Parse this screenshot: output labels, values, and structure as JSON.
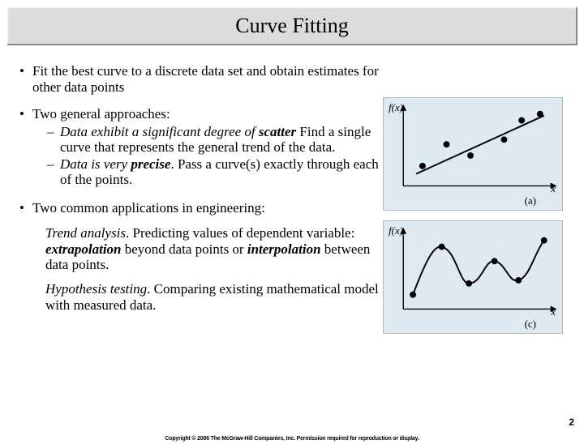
{
  "title": "Curve Fitting",
  "bullets": {
    "b1": "Fit the best curve to a discrete data set and obtain estimates for other data points",
    "b2": {
      "lead": "Two general approaches:",
      "s1_em": "Data exhibit a significant degree of ",
      "s1_bold": "scatter",
      "s1_tail": " Find a single curve that represents the general trend of the data.",
      "s2_em": "Data is very ",
      "s2_bold": "precise",
      "s2_tail": ". Pass a curve(s) exactly through each of the points."
    },
    "b3": {
      "lead": "Two common applications in engineering:",
      "p1_title": "Trend analysis",
      "p1_body1": ". Predicting values of dependent variable: ",
      "p1_kw1": "extrapolation",
      "p1_body2": " beyond data points or ",
      "p1_kw2": "interpolation",
      "p1_body3": " between data points.",
      "p2_title": "Hypothesis testing",
      "p2_body": ". Comparing existing mathematical model with measured data."
    }
  },
  "figures": {
    "a": {
      "y_label": "f(x)",
      "x_label": "x",
      "tag": "(a)"
    },
    "c": {
      "y_label": "f(x)",
      "x_label": "x",
      "tag": "(c)"
    }
  },
  "chart_data": [
    {
      "type": "scatter",
      "tag": "(a)",
      "note": "scatter points with a straight trend line",
      "points": [
        {
          "x": 0.1,
          "y": 0.3
        },
        {
          "x": 0.28,
          "y": 0.55
        },
        {
          "x": 0.45,
          "y": 0.42
        },
        {
          "x": 0.7,
          "y": 0.6
        },
        {
          "x": 0.82,
          "y": 0.83
        },
        {
          "x": 0.93,
          "y": 0.92
        }
      ],
      "line": {
        "x0": 0.05,
        "y0": 0.25,
        "x1": 0.95,
        "y1": 0.9
      }
    },
    {
      "type": "line",
      "tag": "(c)",
      "note": "smooth curve passing through all points",
      "points": [
        {
          "x": 0.06,
          "y": 0.22
        },
        {
          "x": 0.24,
          "y": 0.73
        },
        {
          "x": 0.42,
          "y": 0.35
        },
        {
          "x": 0.62,
          "y": 0.6
        },
        {
          "x": 0.78,
          "y": 0.4
        },
        {
          "x": 0.92,
          "y": 0.88
        }
      ]
    }
  ],
  "page_number": "2",
  "copyright": "Copyright © 2006 The McGraw-Hill Companies, Inc. Permission required for reproduction or display."
}
